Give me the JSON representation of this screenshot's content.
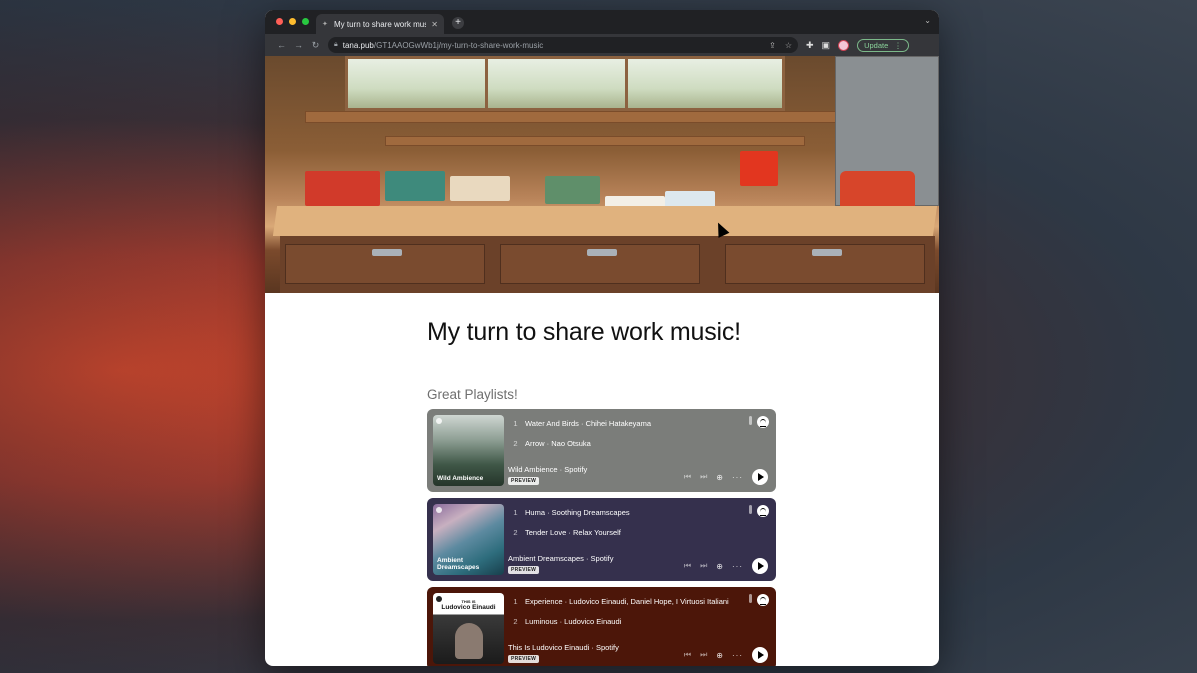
{
  "browser": {
    "tab_title": "My turn to share work music!",
    "tab_close": "✕",
    "new_tab": "+",
    "url_host": "tana.pub",
    "url_path": "/GT1AAOGwWb1j/my-turn-to-share-work-music",
    "update_label": "Update"
  },
  "page": {
    "title": "My turn to share work music!",
    "section_title": "Great Playlists!"
  },
  "playlists": [
    {
      "cover_label": "Wild Ambience",
      "tracks": [
        {
          "num": "1",
          "title": "Water And Birds · Chihei Hatakeyama"
        },
        {
          "num": "2",
          "title": "Arrow · Nao Otsuka"
        }
      ],
      "meta": "Wild Ambience · Spotify",
      "badge": "PREVIEW",
      "bg_color": "#7b7d7a"
    },
    {
      "cover_label": "Ambient Dreamscapes",
      "tracks": [
        {
          "num": "1",
          "title": "Huma · Soothing Dreamscapes"
        },
        {
          "num": "2",
          "title": "Tender Love · Relax Yourself"
        }
      ],
      "meta": "Ambient Dreamscapes · Spotify",
      "badge": "PREVIEW",
      "bg_color": "#35304d"
    },
    {
      "cover_label_top": "THIS IS",
      "cover_label": "Ludovico Einaudi",
      "tracks": [
        {
          "num": "1",
          "title": "Experience · Ludovico Einaudi, Daniel Hope, I Virtuosi Italiani"
        },
        {
          "num": "2",
          "title": "Luminous · Ludovico Einaudi"
        }
      ],
      "meta": "This Is Ludovico Einaudi · Spotify",
      "badge": "PREVIEW",
      "bg_color": "#4c1609"
    }
  ]
}
